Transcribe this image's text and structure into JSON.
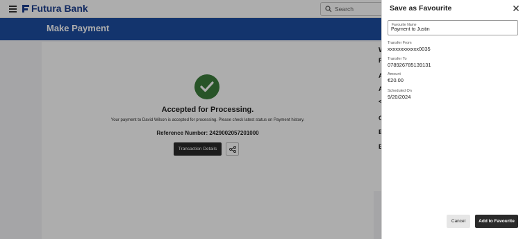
{
  "app": {
    "brand": "Futura Bank"
  },
  "search": {
    "placeholder": "Search"
  },
  "page": {
    "title": "Make Payment"
  },
  "confirmation": {
    "headline": "Accepted for Processing.",
    "message": "Your payment to David Wilson is accepted for processing. Please check latest status on Payment history.",
    "reference_label": "Reference Number:",
    "reference_number": "2429002057201000",
    "transaction_details_label": "Transaction Details"
  },
  "side_fragments": [
    "W",
    "P",
    "A",
    "A",
    "<",
    "C",
    "E",
    "E"
  ],
  "drawer": {
    "title": "Save as Favourite",
    "favourite_name_label": "Favourite Name",
    "favourite_name_value": "Payment to Justin",
    "fields": [
      {
        "label": "Transfer From",
        "value": "xxxxxxxxxxxx0035"
      },
      {
        "label": "Transfer To",
        "value": "078926785139131"
      },
      {
        "label": "Amount",
        "value": "€20.00"
      },
      {
        "label": "Scheduled On",
        "value": "9/20/2024"
      }
    ],
    "cancel_label": "Cancel",
    "add_label": "Add to Favourite"
  },
  "colors": {
    "brand_blue": "#1d4da1",
    "success_green": "#3c7d3c",
    "primary_button": "#2a2a2a"
  }
}
